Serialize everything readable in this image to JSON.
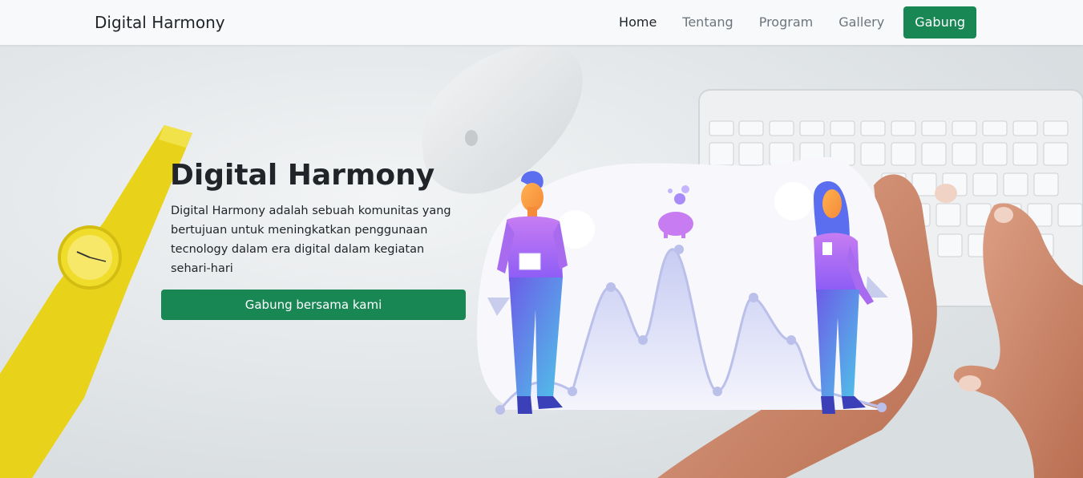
{
  "navbar": {
    "brand": "Digital Harmony",
    "links": [
      {
        "label": "Home",
        "active": true
      },
      {
        "label": "Tentang",
        "active": false
      },
      {
        "label": "Program",
        "active": false
      },
      {
        "label": "Gallery",
        "active": false
      }
    ],
    "cta_label": "Gabung"
  },
  "hero": {
    "title": "Digital Harmony",
    "description": "Digital Harmony adalah sebuah komunitas yang bertujuan untuk meningkatkan penggunaan tecnology dalam era digital dalam kegiatan sehari-hari",
    "cta_label": "Gabung bersama kami"
  },
  "colors": {
    "primary_green": "#198754",
    "navbar_bg": "#f8f9fa",
    "text_dark": "#212529",
    "text_muted": "#6c757d"
  }
}
